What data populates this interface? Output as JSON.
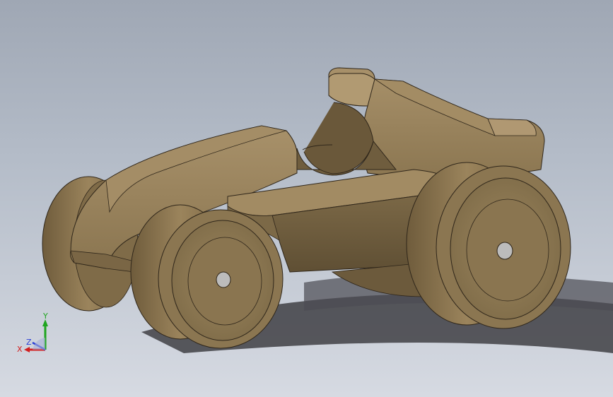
{
  "viewport": {
    "background_top": "#9fa7b4",
    "background_bottom": "#d6dae2"
  },
  "model": {
    "name": "toy race car",
    "color": "#8f7a55",
    "shadow_color": "#4a4a4e"
  },
  "triad": {
    "x_label": "X",
    "y_label": "Y",
    "z_label": "Z",
    "x_color": "#d21e1e",
    "y_color": "#1fa51f",
    "z_color": "#2a3fd6"
  }
}
